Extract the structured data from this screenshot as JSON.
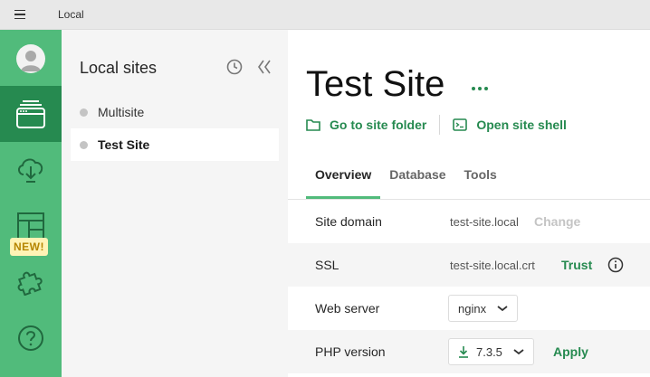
{
  "window": {
    "title": "Local"
  },
  "rail": {
    "new_badge": "NEW!",
    "icons": [
      "avatar-icon",
      "sites-icon",
      "cloud-download-icon",
      "blueprint-icon",
      "addons-icon",
      "help-icon"
    ]
  },
  "sites_panel": {
    "heading": "Local sites",
    "items": [
      {
        "label": "Multisite",
        "selected": false
      },
      {
        "label": "Test Site",
        "selected": true
      }
    ]
  },
  "site": {
    "title": "Test Site",
    "links": {
      "folder": "Go to site folder",
      "shell": "Open site shell"
    },
    "tabs": [
      "Overview",
      "Database",
      "Tools"
    ],
    "rows": {
      "domain": {
        "label": "Site domain",
        "value": "test-site.local",
        "action": "Change"
      },
      "ssl": {
        "label": "SSL",
        "value": "test-site.local.crt",
        "action": "Trust"
      },
      "webserver": {
        "label": "Web server",
        "value": "nginx"
      },
      "php": {
        "label": "PHP version",
        "value": "7.3.5",
        "action": "Apply"
      }
    }
  },
  "colors": {
    "brand_green": "#51bb7b",
    "brand_dark_green": "#268a50",
    "link_green": "#268a50",
    "badge_bg": "#fff3b5"
  }
}
